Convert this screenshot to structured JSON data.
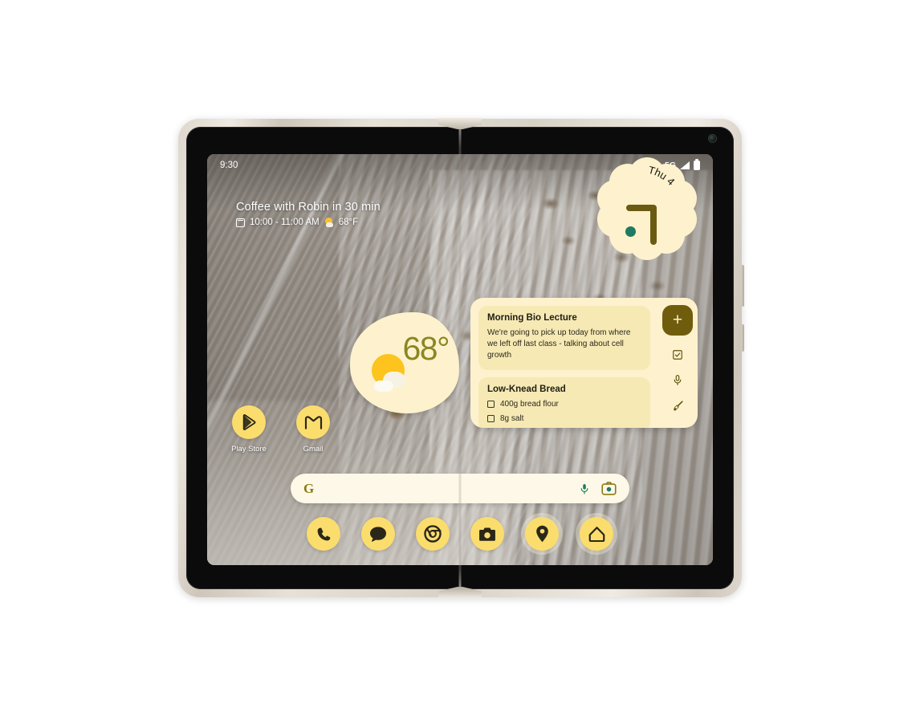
{
  "device": {
    "name": "foldable-phone",
    "frame_color": "#ded7cd",
    "bezel_color": "#0b0b0b"
  },
  "status_bar": {
    "time": "9:30",
    "network": "5G",
    "signal_icon": "signal-bars-icon",
    "battery_icon": "battery-full-icon"
  },
  "at_a_glance": {
    "title": "Coffee with Robin in 30 min",
    "calendar_icon": "calendar-icon",
    "time_range": "10:00 - 11:00 AM",
    "weather_icon": "sun-behind-cloud-icon",
    "temperature": "68°F"
  },
  "weather_widget": {
    "name": "weather-widget",
    "temperature": "68°",
    "icon": "sun-behind-cloud-icon",
    "bg_color": "#fdf2cd",
    "text_color": "#8a8722"
  },
  "clock_widget": {
    "name": "clock-widget",
    "day_label": "Thu 4",
    "bg_color": "#fdf2cd",
    "hand_color": "#6b5a12",
    "dot_color": "#1f7a62"
  },
  "notes_widget": {
    "name": "google-keep-widget",
    "bg_color": "#fdf2cd",
    "card_color": "#f6e9b4",
    "notes": [
      {
        "title": "Morning Bio Lecture",
        "body": "We're going to pick up today from where we left off last class - talking about cell growth"
      },
      {
        "title": "Low-Knead Bread",
        "items": [
          "400g bread flour",
          "8g salt"
        ]
      }
    ],
    "actions": [
      {
        "name": "add-note-button",
        "label": "+",
        "icon": "plus-icon"
      },
      {
        "name": "new-list-button",
        "icon": "checkbox-icon"
      },
      {
        "name": "voice-note-button",
        "icon": "microphone-icon"
      },
      {
        "name": "drawing-note-button",
        "icon": "brush-icon"
      }
    ]
  },
  "apps": [
    {
      "name": "play-store",
      "label": "Play Store",
      "icon": "play-store-icon"
    },
    {
      "name": "gmail",
      "label": "Gmail",
      "icon": "gmail-icon"
    }
  ],
  "search": {
    "name": "google-search-bar",
    "logo": "google-g-icon",
    "placeholder": "",
    "value": "",
    "voice_icon": "microphone-icon",
    "lens_icon": "google-lens-icon"
  },
  "dock": [
    {
      "name": "phone",
      "icon": "phone-icon"
    },
    {
      "name": "messages",
      "icon": "message-bubble-icon"
    },
    {
      "name": "chrome",
      "icon": "chrome-icon"
    },
    {
      "name": "camera",
      "icon": "camera-icon"
    },
    {
      "name": "maps",
      "icon": "map-pin-icon"
    },
    {
      "name": "home",
      "icon": "home-icon"
    }
  ],
  "theme": {
    "accent_yellow": "#fbdd6e",
    "widget_cream": "#fdf2cd",
    "olive": "#6f5d0d",
    "teal": "#1f7a62"
  }
}
